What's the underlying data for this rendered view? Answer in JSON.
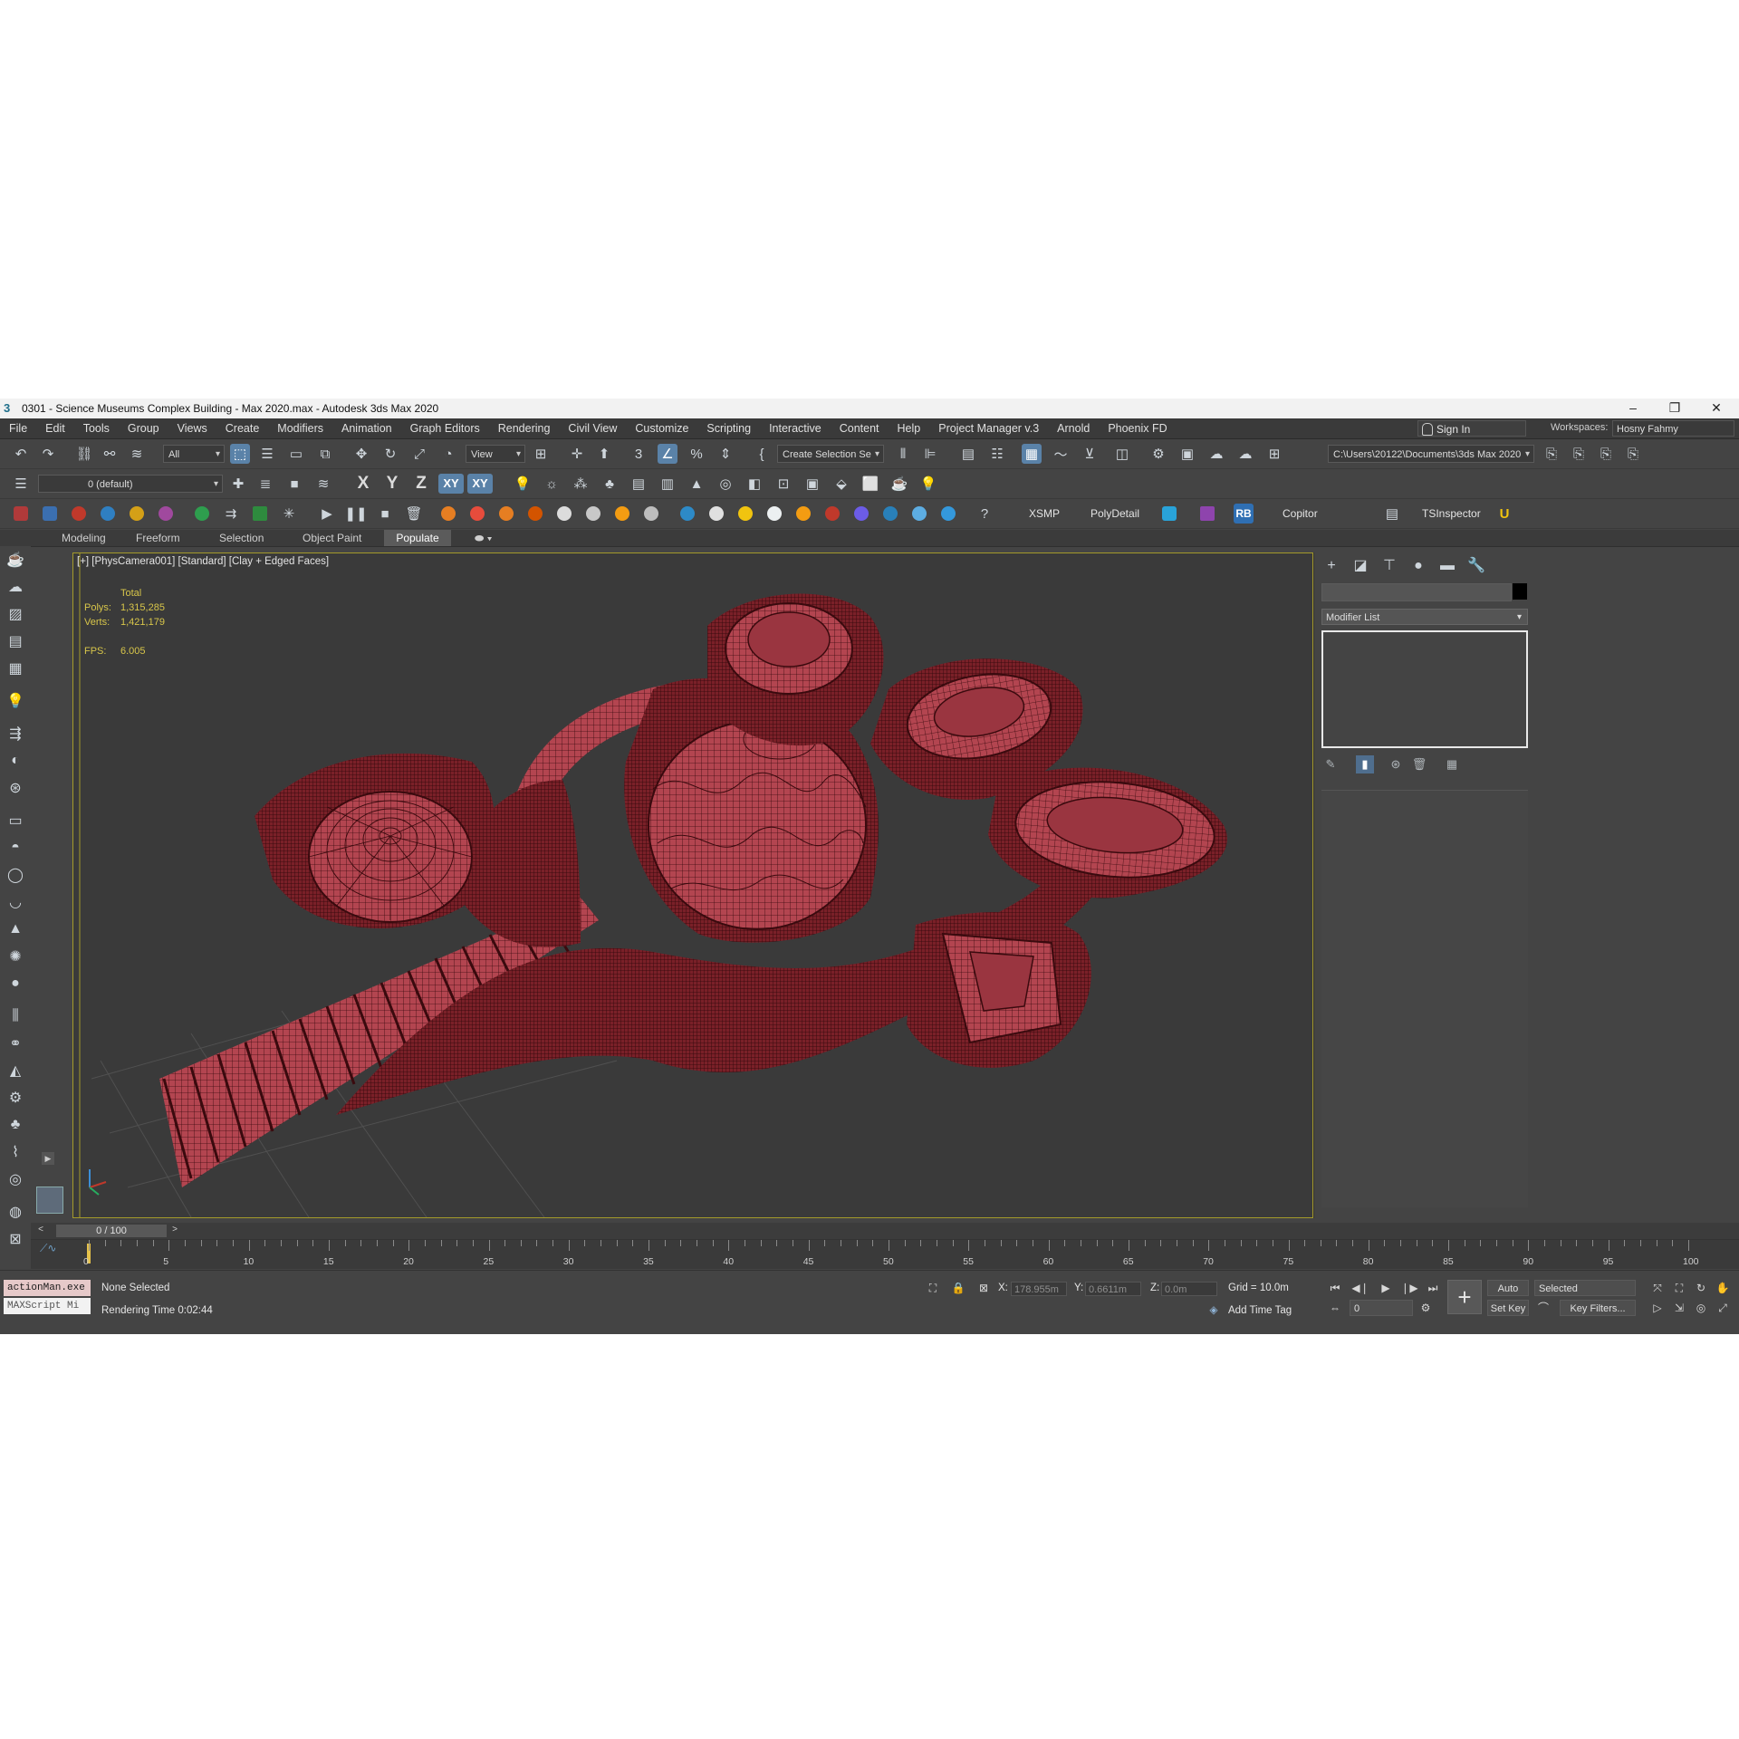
{
  "window": {
    "title": "0301 - Science Museums Complex Building - Max 2020.max - Autodesk 3ds Max 2020",
    "app_icon": "3",
    "controls": [
      "–",
      "❐",
      "✕"
    ]
  },
  "menubar": {
    "items": [
      "File",
      "Edit",
      "Tools",
      "Group",
      "Views",
      "Create",
      "Modifiers",
      "Animation",
      "Graph Editors",
      "Rendering",
      "Civil View",
      "Customize",
      "Scripting",
      "Interactive",
      "Content",
      "Help",
      "Project Manager v.3",
      "Arnold",
      "Phoenix FD"
    ],
    "sign_in": "Sign In",
    "workspaces_label": "Workspaces:",
    "workspace_value": "Hosny Fahmy"
  },
  "toolbar1": {
    "selection_filter": "All",
    "ref_coord": "View",
    "named_selection": "Create Selection Se",
    "project_path": "C:\\Users\\20122\\Documents\\3ds Max 2020"
  },
  "toolbar2": {
    "layer": "0 (default)",
    "axes": [
      "X",
      "Y",
      "Z",
      "XY",
      "XY"
    ]
  },
  "toolbar3": {
    "plugins": [
      "XSMP",
      "PolyDetail",
      "RB",
      "Copitor",
      "TSInspector"
    ]
  },
  "ribbon": {
    "tabs": [
      "Modeling",
      "Freeform",
      "Selection",
      "Object Paint",
      "Populate"
    ],
    "active": "Populate"
  },
  "viewport": {
    "label": "[+] [PhysCamera001] [Standard] [Clay + Edged Faces]",
    "stats_header": "Total",
    "polys_label": "Polys:",
    "polys": "1,315,285",
    "verts_label": "Verts:",
    "verts": "1,421,179",
    "fps_label": "FPS:",
    "fps": "6.005",
    "model_color": "#b8474f",
    "wire_color": "#3a0a0e"
  },
  "command_panel": {
    "modifier_list": "Modifier List"
  },
  "timeline": {
    "slider": "0 / 100",
    "ticks": [
      "0",
      "5",
      "10",
      "15",
      "20",
      "25",
      "30",
      "35",
      "40",
      "45",
      "50",
      "55",
      "60",
      "65",
      "70",
      "75",
      "80",
      "85",
      "90",
      "95",
      "100"
    ]
  },
  "status": {
    "script_listener": "actionMan.exe",
    "script_mini": "MAXScript Mi",
    "selection": "None Selected",
    "render_time": "Rendering Time  0:02:44",
    "x_label": "X:",
    "x_value": "178.955m",
    "y_label": "Y:",
    "y_value": "0.6611m",
    "z_label": "Z:",
    "z_value": "0.0m",
    "grid": "Grid = 10.0m",
    "add_time_tag": "Add Time Tag",
    "auto_key": "Auto Key",
    "selected": "Selected",
    "set_key": "Set Key",
    "key_filters": "Key Filters...",
    "frame": "0"
  }
}
